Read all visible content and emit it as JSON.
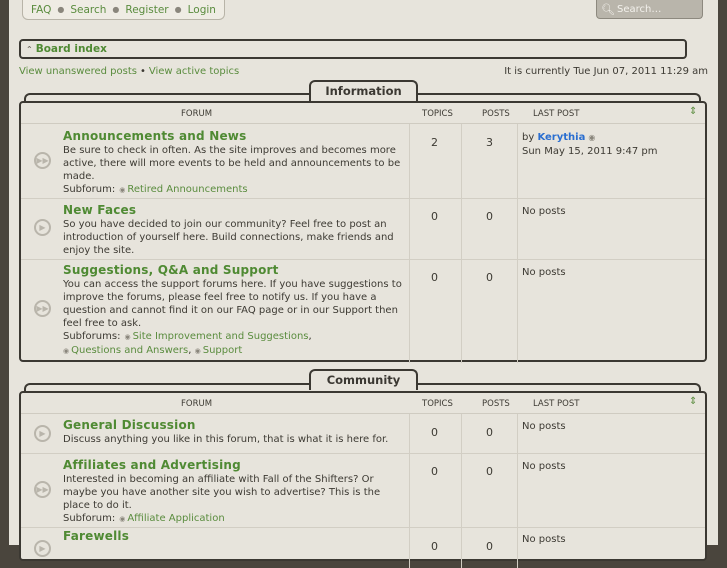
{
  "topnav": {
    "faq": "FAQ",
    "search": "Search",
    "register": "Register",
    "login": "Login"
  },
  "search": {
    "placeholder": "Search…"
  },
  "breadcrumb": {
    "label": "Board index"
  },
  "subline": {
    "unanswered": "View unanswered posts",
    "active": "View active topics",
    "current_time": "It is currently Tue Jun 07, 2011 11:29 am"
  },
  "headers": {
    "forum": "FORUM",
    "topics": "TOPICS",
    "posts": "POSTS",
    "last_post": "LAST POST"
  },
  "categories": [
    {
      "name": "Information",
      "forums": [
        {
          "title": "Announcements and News",
          "desc": "Be sure to check in often. As the site improves and becomes more active, there will more events to be held and announcements to be made.",
          "subforum_label": "Subforum:",
          "subforums": [
            "Retired Announcements"
          ],
          "topics": "2",
          "posts": "3",
          "last_by": "by",
          "last_user": "Kerythia",
          "last_date": "Sun May 15, 2011 9:47 pm"
        },
        {
          "title": "New Faces",
          "desc": "So you have decided to join our community? Feel free to post an introduction of yourself here. Build connections, make friends and enjoy the site.",
          "topics": "0",
          "posts": "0",
          "last": "No posts"
        },
        {
          "title": "Suggestions, Q&A and Support",
          "desc": "You can access the support forums here. If you have suggestions to improve the forums, please feel free to notify us. If you have a question and cannot find it on our FAQ page or in our Support then feel free to ask.",
          "subforum_label": "Subforums:",
          "subforums": [
            "Site Improvement and Suggestions",
            "Questions and Answers",
            "Support"
          ],
          "topics": "0",
          "posts": "0",
          "last": "No posts"
        }
      ]
    },
    {
      "name": "Community",
      "forums": [
        {
          "title": "General Discussion",
          "desc": "Discuss anything you like in this forum, that is what it is here for.",
          "topics": "0",
          "posts": "0",
          "last": "No posts"
        },
        {
          "title": "Affiliates and Advertising",
          "desc": "Interested in becoming an affiliate with Fall of the Shifters? Or maybe you have another site you wish to advertise? This is the place to do it.",
          "subforum_label": "Subforum:",
          "subforums": [
            "Affiliate Application"
          ],
          "topics": "0",
          "posts": "0",
          "last": "No posts"
        },
        {
          "title": "Farewells",
          "topics": "0",
          "posts": "0",
          "last": "No posts"
        }
      ]
    }
  ]
}
